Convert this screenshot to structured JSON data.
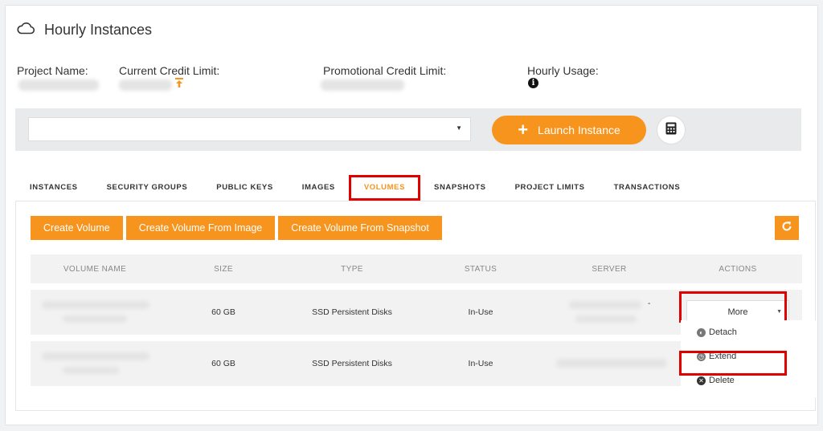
{
  "header": {
    "title": "Hourly Instances",
    "icon": "cloud-icon"
  },
  "info": {
    "project_name_label": "Project Name:",
    "current_credit_label": "Current Credit Limit:",
    "promo_credit_label": "Promotional Credit Limit:",
    "hourly_usage_label": "Hourly Usage:",
    "info_glyph": "i"
  },
  "toolbar": {
    "select_caret": "▼",
    "launch_label": "Launch Instance",
    "launch_plus": "+"
  },
  "tabs": [
    {
      "label": "INSTANCES"
    },
    {
      "label": "SECURITY GROUPS"
    },
    {
      "label": "PUBLIC KEYS"
    },
    {
      "label": "IMAGES"
    },
    {
      "label": "VOLUMES"
    },
    {
      "label": "SNAPSHOTS"
    },
    {
      "label": "PROJECT LIMITS"
    },
    {
      "label": "TRANSACTIONS"
    }
  ],
  "actions": {
    "create_volume": "Create Volume",
    "create_from_image": "Create Volume From Image",
    "create_from_snapshot": "Create Volume From Snapshot"
  },
  "table": {
    "columns": [
      "VOLUME NAME",
      "SIZE",
      "TYPE",
      "STATUS",
      "SERVER",
      "ACTIONS"
    ],
    "rows": [
      {
        "size": "60 GB",
        "type": "SSD Persistent Disks",
        "status": "In-Use",
        "server_suffix": "-"
      },
      {
        "size": "60 GB",
        "type": "SSD Persistent Disks",
        "status": "In-Use",
        "server_suffix": ""
      }
    ],
    "more_label": "More",
    "more_caret": "▼"
  },
  "menu": {
    "detach": "Detach",
    "extend": "Extend",
    "delete": "Delete"
  },
  "colors": {
    "accent": "#f7941d",
    "highlight": "#e00000"
  }
}
